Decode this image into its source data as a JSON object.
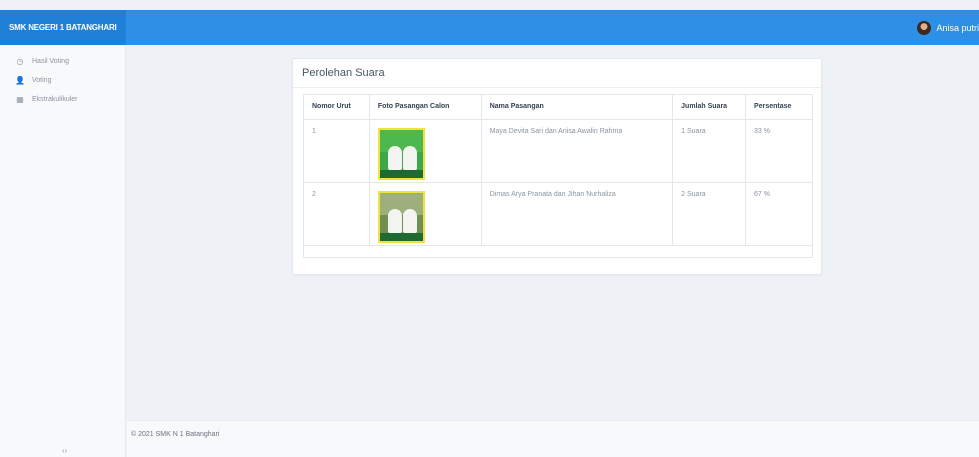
{
  "topbar": {
    "brand": "SMK NEGERI 1 BATANGHARI",
    "user_name": "Anisa putri"
  },
  "sidebar": {
    "items": [
      {
        "label": "Hasil Voting",
        "icon": "clock-icon"
      },
      {
        "label": "Voting",
        "icon": "user-plus-icon"
      },
      {
        "label": "Ekstrakulikuler",
        "icon": "grid-icon"
      }
    ]
  },
  "card": {
    "title": "Perolehan Suara",
    "columns": [
      "Nomor Urut",
      "Foto Pasangan Calon",
      "Nama Pasangan",
      "Jumlah Suara",
      "Persentase"
    ],
    "rows": [
      {
        "nomor": "1",
        "nama": "Maya Devita Sari dan Anisa Awalin Rahma",
        "jumlah": "1 Suara",
        "persentase": "33 %"
      },
      {
        "nomor": "2",
        "nama": "Dimas Arya Pranata dan Jihan Nurhaliza",
        "jumlah": "2 Suara",
        "persentase": "67 %"
      }
    ]
  },
  "footer": {
    "text": "© 2021 SMK N 1 Batanghari"
  },
  "colors": {
    "topbar": "#2d8fe6",
    "brand_bg": "#1f80d8",
    "page_bg": "#eef2f6"
  }
}
